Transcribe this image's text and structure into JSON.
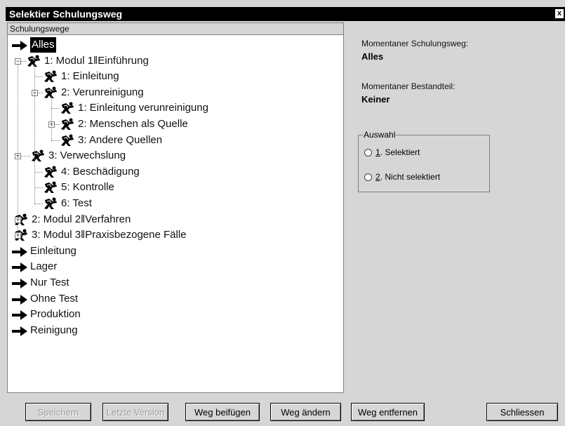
{
  "window": {
    "title": "Selektier Schulungsweg",
    "close_label": "x"
  },
  "tree_panel": {
    "header": "Schulungswege"
  },
  "tree": {
    "items": [
      {
        "label": "Alles",
        "icon": "arrow-icon",
        "selected": true
      },
      {
        "label": "1: Modul 1‖Einführung",
        "icon": "figure-icon",
        "expander": "−"
      },
      {
        "label": "1: Einleitung",
        "icon": "figure-icon"
      },
      {
        "label": "2: Verunreinigung",
        "icon": "figure-icon",
        "expander": "−"
      },
      {
        "label": "1: Einleitung verunreinigung",
        "icon": "figure-icon"
      },
      {
        "label": "2: Menschen als Quelle",
        "icon": "figure-icon",
        "expander": "+"
      },
      {
        "label": "3: Andere Quellen",
        "icon": "figure-icon"
      },
      {
        "label": "3: Verwechslung",
        "icon": "figure-icon",
        "expander": "+"
      },
      {
        "label": "4: Beschädigung",
        "icon": "figure-icon"
      },
      {
        "label": "5: Kontrolle",
        "icon": "figure-icon"
      },
      {
        "label": "6: Test",
        "icon": "figure-icon"
      },
      {
        "label": "2: Modul 2‖Verfahren",
        "icon": "figure-icon",
        "expander": "+"
      },
      {
        "label": "3: Modul 3‖Praxisbezogene Fälle",
        "icon": "figure-icon",
        "expander": "+"
      },
      {
        "label": "Einleitung",
        "icon": "arrow-icon"
      },
      {
        "label": "Lager",
        "icon": "arrow-icon"
      },
      {
        "label": "Nur Test",
        "icon": "arrow-icon"
      },
      {
        "label": "Ohne Test",
        "icon": "arrow-icon"
      },
      {
        "label": "Produktion",
        "icon": "arrow-icon"
      },
      {
        "label": "Reinigung",
        "icon": "arrow-icon"
      }
    ]
  },
  "info": {
    "current_path_label": "Momentaner Schulungsweg:",
    "current_path_value": "Alles",
    "current_part_label": "Momentaner Bestandteil:",
    "current_part_value": "Keiner"
  },
  "selection": {
    "caption": "Auswahl",
    "option1_key": "1",
    "option1_text": ". Selektiert",
    "option2_key": "2",
    "option2_text": ". Nicht selektiert"
  },
  "buttons": {
    "save": "Speichern",
    "last_version": "Letzte Version",
    "add_path": "Weg beifügen",
    "change_path": "Weg ändern",
    "remove_path": "Weg entfernen",
    "close": "Schliessen"
  },
  "colors": {
    "background": "#d6d6d6",
    "titlebar": "#000000",
    "selection": "#000000"
  }
}
